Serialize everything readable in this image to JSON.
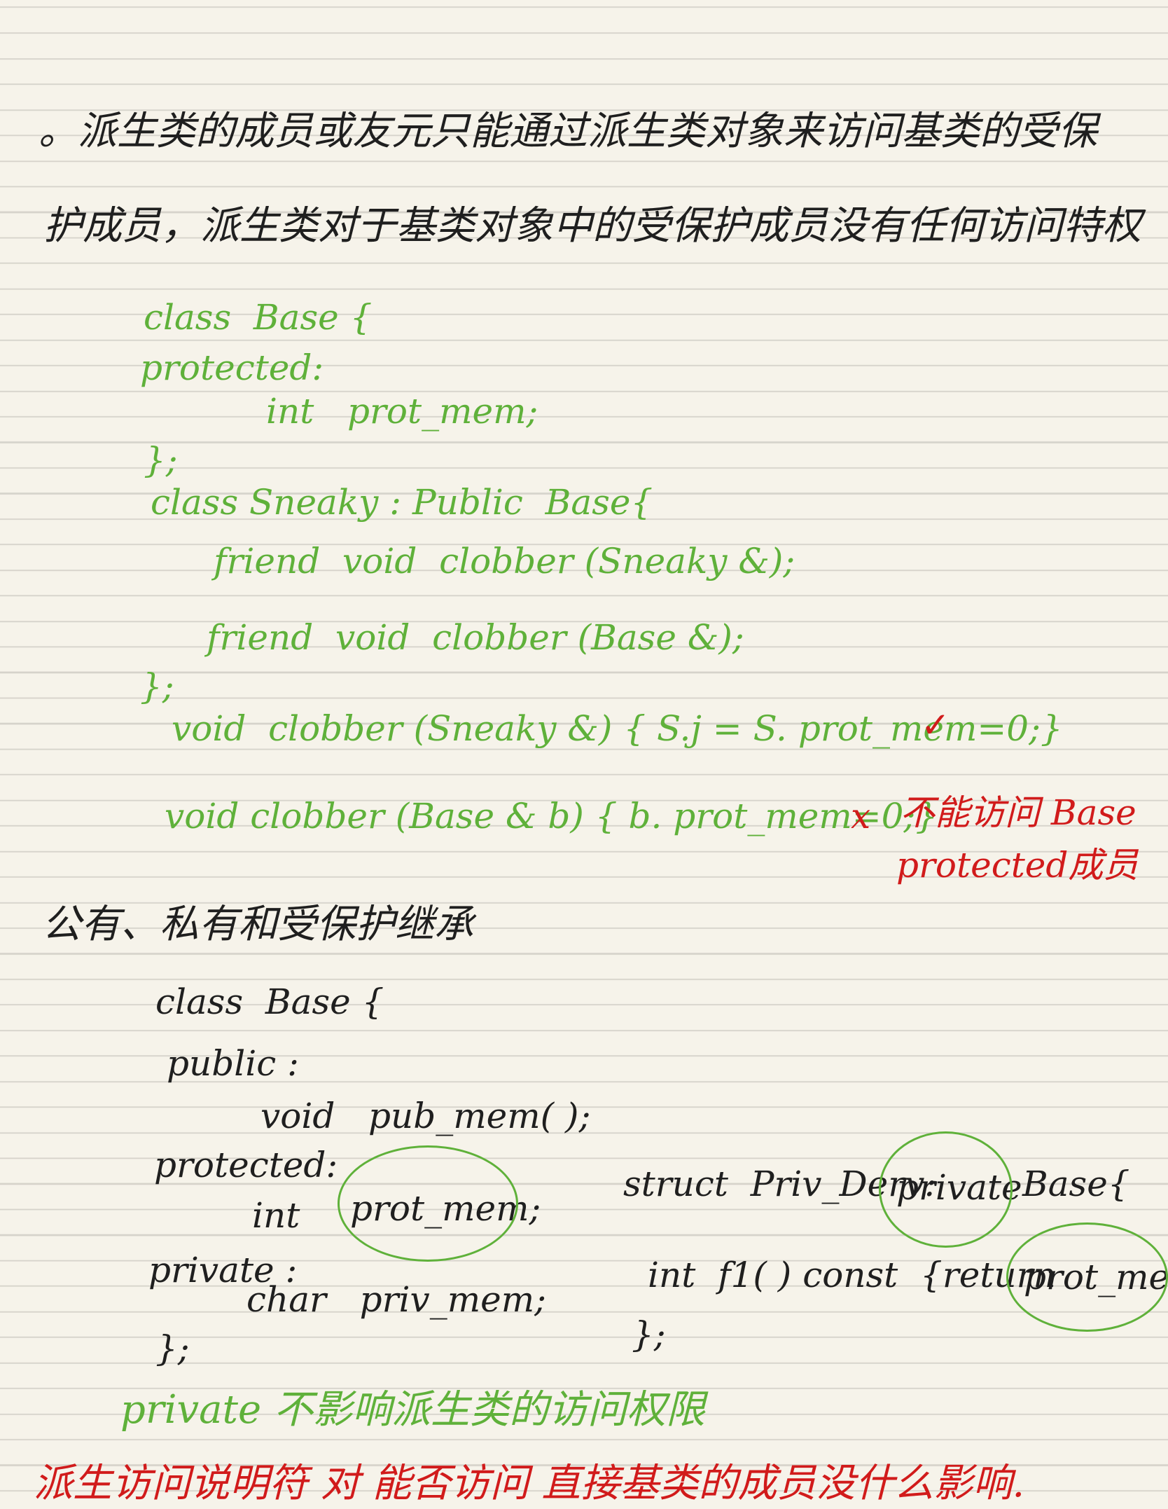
{
  "notes": {
    "para1_line1": "。派生类的成员或友元只能通过派生类对象来访问基类的受保",
    "para1_line2": "护成员，派生类对于基类对象中的受保护成员没有任何访问特权",
    "code1": [
      "class  Base {",
      "protected:",
      "int   prot_mem;",
      "};",
      "class Sneaky : Public  Base{",
      "friend  void  clobber (Sneaky &);",
      "friend  void  clobber (Base &);",
      "};",
      "void  clobber (Sneaky &) { S.j = S. prot_mem=0;}",
      "void clobber (Base & b) { b. prot_mem=0;}"
    ],
    "check_mark": "✓",
    "x_mark": "x",
    "annotation_line1": "不能访问 Base",
    "annotation_line2": "protected成员",
    "section_heading": "公有、私有和受保护继承",
    "code2": [
      "class  Base {",
      "public :",
      "void   pub_mem( );",
      "protected:",
      "int",
      "prot_mem;",
      "private :",
      "char   priv_mem;",
      "};"
    ],
    "code3": {
      "struct_prefix": "struct  Priv_Derv:",
      "struct_access": "private",
      "struct_suffix": "Base{",
      "func_prefix": "int  f1( ) const  {return",
      "func_member": "prot_mem;}",
      "close": "};"
    },
    "green_note": "private 不影响派生类的访问权限",
    "red_note": "派生访问说明符 对 能否访问 直接基类的成员没什么影响."
  }
}
